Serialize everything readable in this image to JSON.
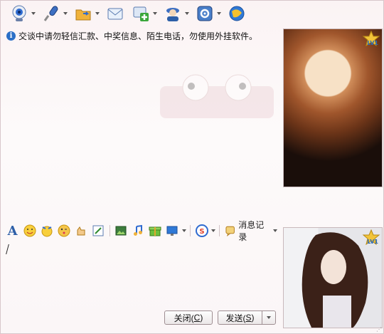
{
  "toolbar": {
    "items": [
      {
        "icon": "webcam-icon",
        "has_dropdown": true
      },
      {
        "icon": "microphone-icon",
        "has_dropdown": true
      },
      {
        "icon": "folder-transfer-icon",
        "has_dropdown": true
      },
      {
        "icon": "mail-icon",
        "has_dropdown": false
      },
      {
        "icon": "sms-plus-icon",
        "has_dropdown": true
      },
      {
        "icon": "user-card-icon",
        "has_dropdown": true
      },
      {
        "icon": "settings-app-icon",
        "has_dropdown": true
      },
      {
        "icon": "browser-globe-icon",
        "has_dropdown": false
      }
    ]
  },
  "notice": {
    "text": "交谈中请勿轻信汇款、中奖信息、陌生电话，勿使用外挂软件。"
  },
  "avatars": {
    "level_top": "LV1",
    "level_bottom": "LV1"
  },
  "format_bar": {
    "message_log_label": "消息记录"
  },
  "input": {
    "value": ""
  },
  "buttons": {
    "close_label": "关闭(",
    "close_hotkey": "C",
    "close_suffix": ")",
    "send_label": "发送(",
    "send_hotkey": "S",
    "send_suffix": ")"
  },
  "colors": {
    "accent": "#2d5fa8",
    "background": "#fbf3f4"
  }
}
